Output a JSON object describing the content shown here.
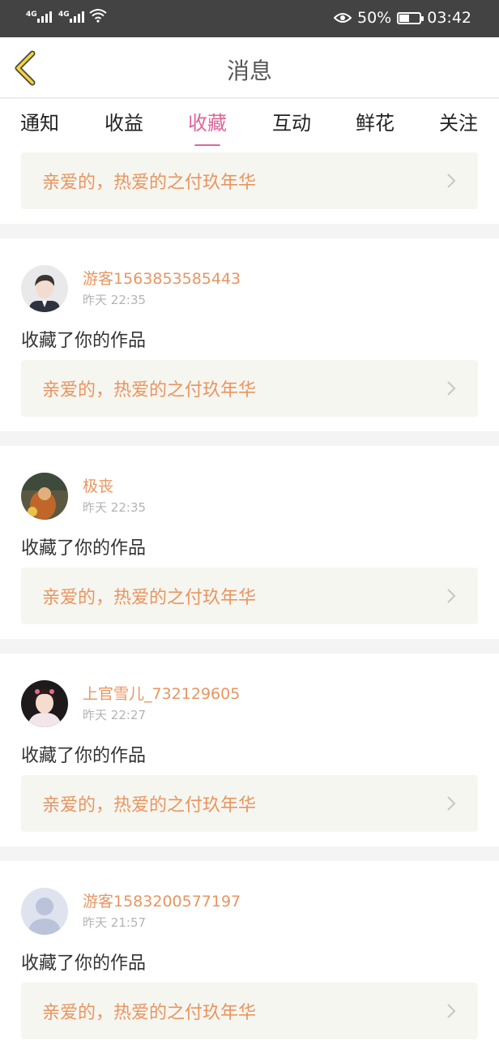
{
  "status_bar": {
    "network_1": "4G",
    "network_2": "4G",
    "battery_text": "50%",
    "battery_level": 0.5,
    "time": "03:42"
  },
  "header": {
    "title": "消息",
    "back_icon": "chevron-left-icon",
    "accent": "#e0659c"
  },
  "tabs": [
    {
      "label": "通知",
      "active": false
    },
    {
      "label": "收益",
      "active": false
    },
    {
      "label": "收藏",
      "active": true
    },
    {
      "label": "互动",
      "active": false
    },
    {
      "label": "鲜花",
      "active": false
    },
    {
      "label": "关注",
      "active": false
    }
  ],
  "top_work": {
    "title": "亲爱的，热爱的之付玖年华"
  },
  "notifications": [
    {
      "user": "游客1563853585443",
      "date": "昨天",
      "time": "22:35",
      "action": "收藏了你的作品",
      "work_title": "亲爱的，热爱的之付玖年华",
      "avatar": "young-man-avatar"
    },
    {
      "user": "极丧",
      "date": "昨天",
      "time": "22:35",
      "action": "收藏了你的作品",
      "work_title": "亲爱的，热爱的之付玖年华",
      "avatar": "dark-photo-avatar"
    },
    {
      "user": "上官雪儿_732129605",
      "date": "昨天",
      "time": "22:27",
      "action": "收藏了你的作品",
      "work_title": "亲爱的，热爱的之付玖年华",
      "avatar": "woman-avatar"
    },
    {
      "user": "游客1583200577197",
      "date": "昨天",
      "time": "21:57",
      "action": "收藏了你的作品",
      "work_title": "亲爱的，热爱的之付玖年华",
      "avatar": "default-person-avatar"
    }
  ],
  "colors": {
    "username": "#e9955f",
    "work_title": "#e9955f",
    "work_bg": "#f6f6f1"
  }
}
